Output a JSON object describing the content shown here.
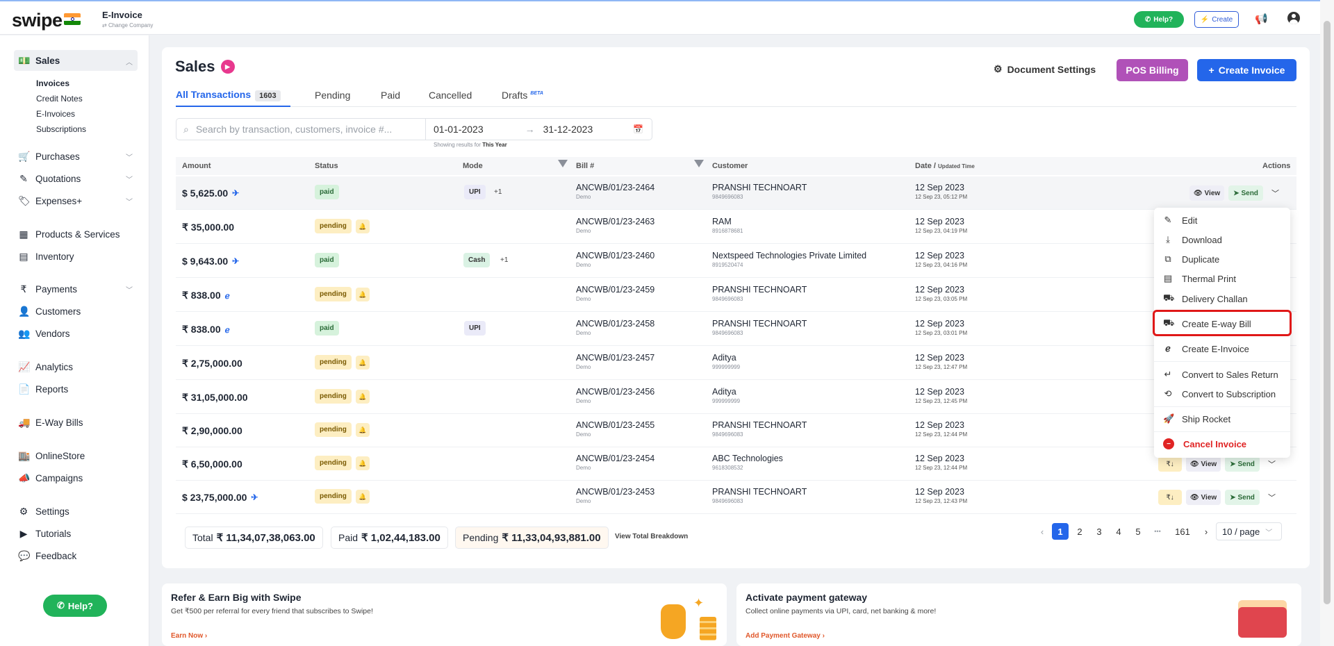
{
  "header": {
    "logo": "swipe",
    "company_title": "E-Invoice",
    "company_sub": "Change Company",
    "help": "Help?",
    "create": "Create"
  },
  "sidebar": {
    "sales": "Sales",
    "sales_sub": [
      "Invoices",
      "Credit Notes",
      "E-Invoices",
      "Subscriptions"
    ],
    "items": [
      {
        "label": "Purchases",
        "icon": "cart-icon"
      },
      {
        "label": "Quotations",
        "icon": "pen-icon"
      },
      {
        "label": "Expenses+",
        "icon": "tag-icon"
      },
      {
        "label": "Products & Services",
        "icon": "products-icon"
      },
      {
        "label": "Inventory",
        "icon": "inventory-icon"
      },
      {
        "label": "Payments",
        "icon": "rupee-icon"
      },
      {
        "label": "Customers",
        "icon": "user-icon"
      },
      {
        "label": "Vendors",
        "icon": "users-icon"
      },
      {
        "label": "Analytics",
        "icon": "chart-icon"
      },
      {
        "label": "Reports",
        "icon": "report-icon"
      },
      {
        "label": "E-Way Bills",
        "icon": "truck-icon"
      },
      {
        "label": "OnlineStore",
        "icon": "store-icon"
      },
      {
        "label": "Campaigns",
        "icon": "megaphone-icon"
      },
      {
        "label": "Settings",
        "icon": "gear-icon"
      },
      {
        "label": "Tutorials",
        "icon": "youtube-icon"
      },
      {
        "label": "Feedback",
        "icon": "chat-icon"
      }
    ],
    "help": "Help?"
  },
  "main": {
    "title": "Sales",
    "document_settings": "Document Settings",
    "pos_billing": "POS Billing",
    "create_invoice": "Create Invoice",
    "tabs": [
      {
        "label": "All Transactions",
        "count": "1603"
      },
      {
        "label": "Pending"
      },
      {
        "label": "Paid"
      },
      {
        "label": "Cancelled"
      },
      {
        "label": "Drafts",
        "badge": "BETA"
      }
    ],
    "search_placeholder": "Search by transaction, customers, invoice #...",
    "date_from": "01-01-2023",
    "date_to": "31-12-2023",
    "showing_prefix": "Showing results for",
    "showing_range": "This Year",
    "columns": {
      "amount": "Amount",
      "status": "Status",
      "mode": "Mode",
      "bill": "Bill #",
      "customer": "Customer",
      "date": "Date /",
      "date_sub": "Updated Time",
      "actions": "Actions"
    },
    "rows": [
      {
        "amount": "$ 5,625.00",
        "status": "paid",
        "mode": "UPI",
        "extra": "+1",
        "bill": "ANCWB/01/23-2464",
        "bill_sub": "Demo",
        "customer": "PRANSHI TECHNOART",
        "phone": "9849696083",
        "date": "12 Sep 2023",
        "time": "12 Sep 23, 05:12 PM"
      },
      {
        "amount": "₹ 35,000.00",
        "status": "pending",
        "mode": "",
        "extra": "",
        "bill": "ANCWB/01/23-2463",
        "bill_sub": "Demo",
        "customer": "RAM",
        "phone": "8916878681",
        "date": "12 Sep 2023",
        "time": "12 Sep 23, 04:19 PM"
      },
      {
        "amount": "$ 9,643.00",
        "status": "paid",
        "mode": "Cash",
        "extra": "+1",
        "bill": "ANCWB/01/23-2460",
        "bill_sub": "Demo",
        "customer": "Nextspeed Technologies Private Limited",
        "phone": "8919520474",
        "date": "12 Sep 2023",
        "time": "12 Sep 23, 04:16 PM"
      },
      {
        "amount": "₹ 838.00",
        "status": "pending",
        "mode": "",
        "extra": "",
        "bill": "ANCWB/01/23-2459",
        "bill_sub": "Demo",
        "customer": "PRANSHI TECHNOART",
        "phone": "9849696083",
        "date": "12 Sep 2023",
        "time": "12 Sep 23, 03:05 PM"
      },
      {
        "amount": "₹ 838.00",
        "status": "paid",
        "mode": "UPI",
        "extra": "",
        "bill": "ANCWB/01/23-2458",
        "bill_sub": "Demo",
        "customer": "PRANSHI TECHNOART",
        "phone": "9849696083",
        "date": "12 Sep 2023",
        "time": "12 Sep 23, 03:01 PM"
      },
      {
        "amount": "₹ 2,75,000.00",
        "status": "pending",
        "mode": "",
        "extra": "",
        "bill": "ANCWB/01/23-2457",
        "bill_sub": "Demo",
        "customer": "Aditya",
        "phone": "999999999",
        "date": "12 Sep 2023",
        "time": "12 Sep 23, 12:47 PM"
      },
      {
        "amount": "₹ 31,05,000.00",
        "status": "pending",
        "mode": "",
        "extra": "",
        "bill": "ANCWB/01/23-2456",
        "bill_sub": "Demo",
        "customer": "Aditya",
        "phone": "999999999",
        "date": "12 Sep 2023",
        "time": "12 Sep 23, 12:45 PM"
      },
      {
        "amount": "₹ 2,90,000.00",
        "status": "pending",
        "mode": "",
        "extra": "",
        "bill": "ANCWB/01/23-2455",
        "bill_sub": "Demo",
        "customer": "PRANSHI TECHNOART",
        "phone": "9849696083",
        "date": "12 Sep 2023",
        "time": "12 Sep 23, 12:44 PM"
      },
      {
        "amount": "₹ 6,50,000.00",
        "status": "pending",
        "mode": "",
        "extra": "",
        "bill": "ANCWB/01/23-2454",
        "bill_sub": "Demo",
        "customer": "ABC Technologies",
        "phone": "9618308532",
        "date": "12 Sep 2023",
        "time": "12 Sep 23, 12:44 PM"
      },
      {
        "amount": "$ 23,75,000.00",
        "status": "pending",
        "mode": "",
        "extra": "",
        "bill": "ANCWB/01/23-2453",
        "bill_sub": "Demo",
        "customer": "PRANSHI TECHNOART",
        "phone": "9849696083",
        "date": "12 Sep 2023",
        "time": "12 Sep 23, 12:43 PM"
      }
    ],
    "actions": {
      "view": "View",
      "send": "Send"
    },
    "totals": {
      "total_label": "Total",
      "total_value": "₹ 11,34,07,38,063.00",
      "paid_label": "Paid",
      "paid_value": "₹ 1,02,44,183.00",
      "pending_label": "Pending",
      "pending_value": "₹ 11,33,04,93,881.00",
      "breakdown": "View Total Breakdown"
    },
    "pagination": {
      "pages": [
        "1",
        "2",
        "3",
        "4",
        "5"
      ],
      "ellipsis": "•••",
      "last": "161",
      "per_page": "10 / page"
    }
  },
  "dropdown": {
    "items": [
      "Edit",
      "Download",
      "Duplicate",
      "Thermal Print",
      "Delivery Challan",
      "Create E-way Bill",
      "Create E-Invoice",
      "Convert to Sales Return",
      "Convert to Subscription",
      "Ship Rocket",
      "Cancel Invoice"
    ]
  },
  "promos": {
    "refer_title": "Refer & Earn Big with Swipe",
    "refer_sub": "Get ₹500 per referral for every friend that subscribes to Swipe!",
    "refer_link": "Earn Now",
    "gateway_title": "Activate payment gateway",
    "gateway_sub": "Collect online payments via UPI, card, net banking & more!",
    "gateway_link": "Add Payment Gateway"
  },
  "colors": {
    "primary": "#2466ea",
    "pos": "#b051b8",
    "success": "#21b35a",
    "danger": "#e02424"
  }
}
